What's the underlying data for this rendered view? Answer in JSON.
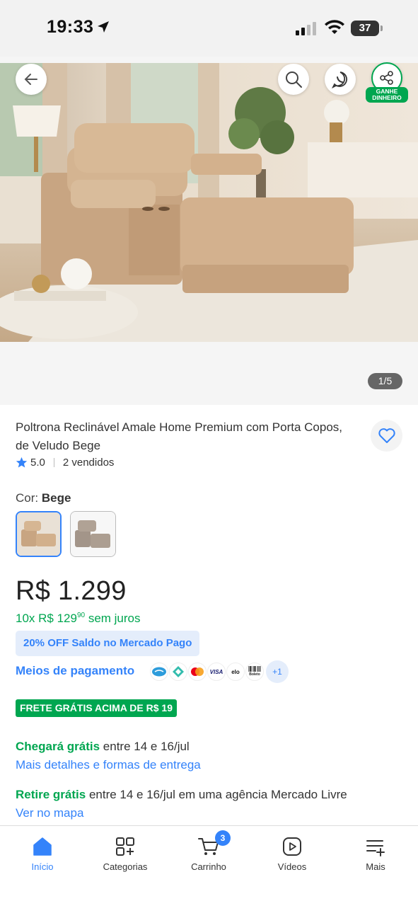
{
  "status_bar": {
    "time": "19:33",
    "battery": "37"
  },
  "gallery": {
    "counter": "1/5",
    "earn_badge_line1": "GANHE",
    "earn_badge_line2": "DINHEIRO"
  },
  "product": {
    "title": "Poltrona Reclinável Amale Home Premium com Porta Copos, de Veludo Bege",
    "rating": "5.0",
    "sold": "2 vendidos",
    "color_label": "Cor:",
    "color_value": "Bege",
    "price": "R$ 1.299",
    "installments_prefix": "10x R$ 129",
    "installments_cents": "90",
    "installments_suffix": "sem juros",
    "promo": "20% OFF Saldo no Mercado Pago",
    "payments_link": "Meios de pagamento",
    "payment_icons": [
      "mercado-pago-icon",
      "pix-icon",
      "mastercard-icon",
      "visa-icon",
      "elo-icon",
      "boleto-icon"
    ],
    "payment_labels": {
      "visa": "VISA",
      "elo": "elo",
      "boleto": "Boleto"
    },
    "payments_more": "+1"
  },
  "shipping": {
    "freight_badge": "FRETE GRÁTIS ACIMA DE R$ 19",
    "arrive_green": "Chegará grátis",
    "arrive_text": "entre 14 e 16/jul",
    "arrive_link": "Mais detalhes e formas de entrega",
    "pickup_green": "Retire grátis",
    "pickup_text": "entre 14 e 16/jul em uma agência Mercado Livre",
    "pickup_link": "Ver no mapa"
  },
  "bottom_nav": {
    "home": "Início",
    "categories": "Categorias",
    "cart": "Carrinho",
    "cart_count": "3",
    "videos": "Vídeos",
    "more": "Mais"
  },
  "colors": {
    "accent": "#3483fa",
    "green": "#00a650",
    "promo_bg": "#e4edfb"
  }
}
